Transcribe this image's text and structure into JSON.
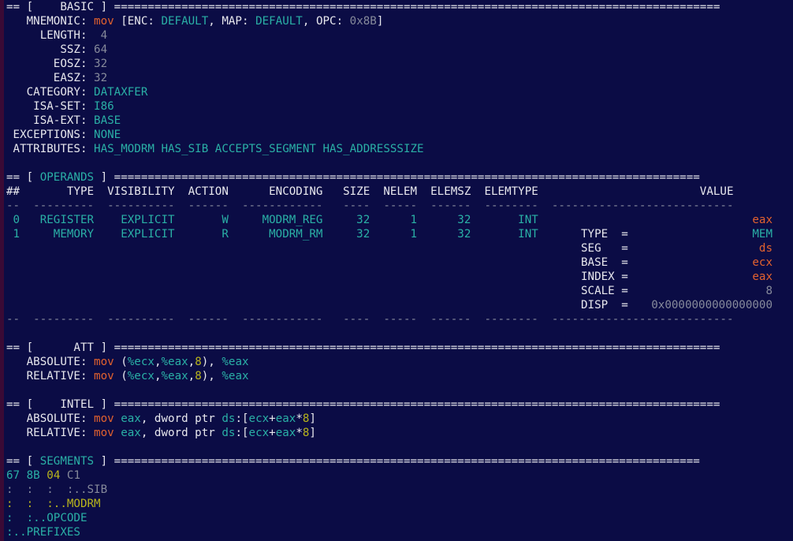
{
  "basic": {
    "header": "== [    BASIC ] ==========================================================================================",
    "mnemonic_label": "   MNEMONIC: ",
    "mnemonic": "mov",
    "enc_open": " [ENC: ",
    "enc": "DEFAULT",
    "map_label": ", MAP: ",
    "map": "DEFAULT",
    "opc_label": ", OPC: ",
    "opc": "0x8B",
    "opc_close": "]",
    "length_label": "     LENGTH: ",
    "length": " 4",
    "ssz_label": "        SSZ: ",
    "ssz": "64",
    "eosz_label": "       EOSZ: ",
    "eosz": "32",
    "easz_label": "       EASZ: ",
    "easz": "32",
    "category_label": "   CATEGORY: ",
    "category": "DATAXFER",
    "isaset_label": "    ISA-SET: ",
    "isaset": "I86",
    "isaext_label": "    ISA-EXT: ",
    "isaext": "BASE",
    "exceptions_label": " EXCEPTIONS: ",
    "exceptions": "NONE",
    "attributes_label": " ATTRIBUTES: ",
    "attributes": "HAS_MODRM HAS_SIB ACCEPTS_SEGMENT HAS_ADDRESSSIZE"
  },
  "operands": {
    "header_pre": "== [ ",
    "header_name": "OPERANDS",
    "header_post": " ] =======================================================================================",
    "columns": "##       TYPE  VISIBILITY  ACTION      ENCODING   SIZE  NELEM  ELEMSZ  ELEMTYPE                        VALUE",
    "dashes": "--  ---------  ----------  ------  ------------   ----  -----  ------  --------  ---------------------------",
    "row0_main": " 0   REGISTER    EXPLICIT       W     MODRM_REG     32      1      32       INT",
    "row0_val": "eax",
    "row1_main": " 1     MEMORY    EXPLICIT       R      MODRM_RM     32      1      32       INT",
    "mem": {
      "type_label": "TYPE  =",
      "type_val": "MEM",
      "seg_label": "SEG   =",
      "seg_val": "ds",
      "base_label": "BASE  =",
      "base_val": "ecx",
      "index_label": "INDEX =",
      "index_val": "eax",
      "scale_label": "SCALE =",
      "scale_val": "8",
      "disp_label": "DISP  =",
      "disp_val": "0x0000000000000000"
    }
  },
  "att": {
    "header": "== [      ATT ] ==========================================================================================",
    "abs_label": "   ABSOLUTE: ",
    "rel_label": "   RELATIVE: ",
    "mnem": "mov",
    "p1": " (",
    "r1": "%ecx",
    "c1": ",",
    "r2": "%eax",
    "c2": ",",
    "scale": "8",
    "p2": "), ",
    "dst": "%eax"
  },
  "intel": {
    "header": "== [    INTEL ] ==========================================================================================",
    "abs_label": "   ABSOLUTE: ",
    "rel_label": "   RELATIVE: ",
    "mnem": "mov",
    "sp": " ",
    "dst": "eax",
    "mid": ", dword ptr ",
    "seg": "ds",
    "br1": ":[",
    "base": "ecx",
    "plus": "+",
    "index": "eax",
    "star": "*",
    "scale": "8",
    "br2": "]"
  },
  "segments": {
    "header_pre": "== [ ",
    "header_name": "SEGMENTS",
    "header_post": " ] =======================================================================================",
    "b_prefix": "67",
    "b_opcode": "8B",
    "b_modrm": "04",
    "b_sib": "C1",
    "sib": ":  :  :  :..SIB",
    "modrm": ":  :  :..MODRM",
    "opcode": ":  :..OPCODE",
    "prefixes": ":..PREFIXES"
  }
}
